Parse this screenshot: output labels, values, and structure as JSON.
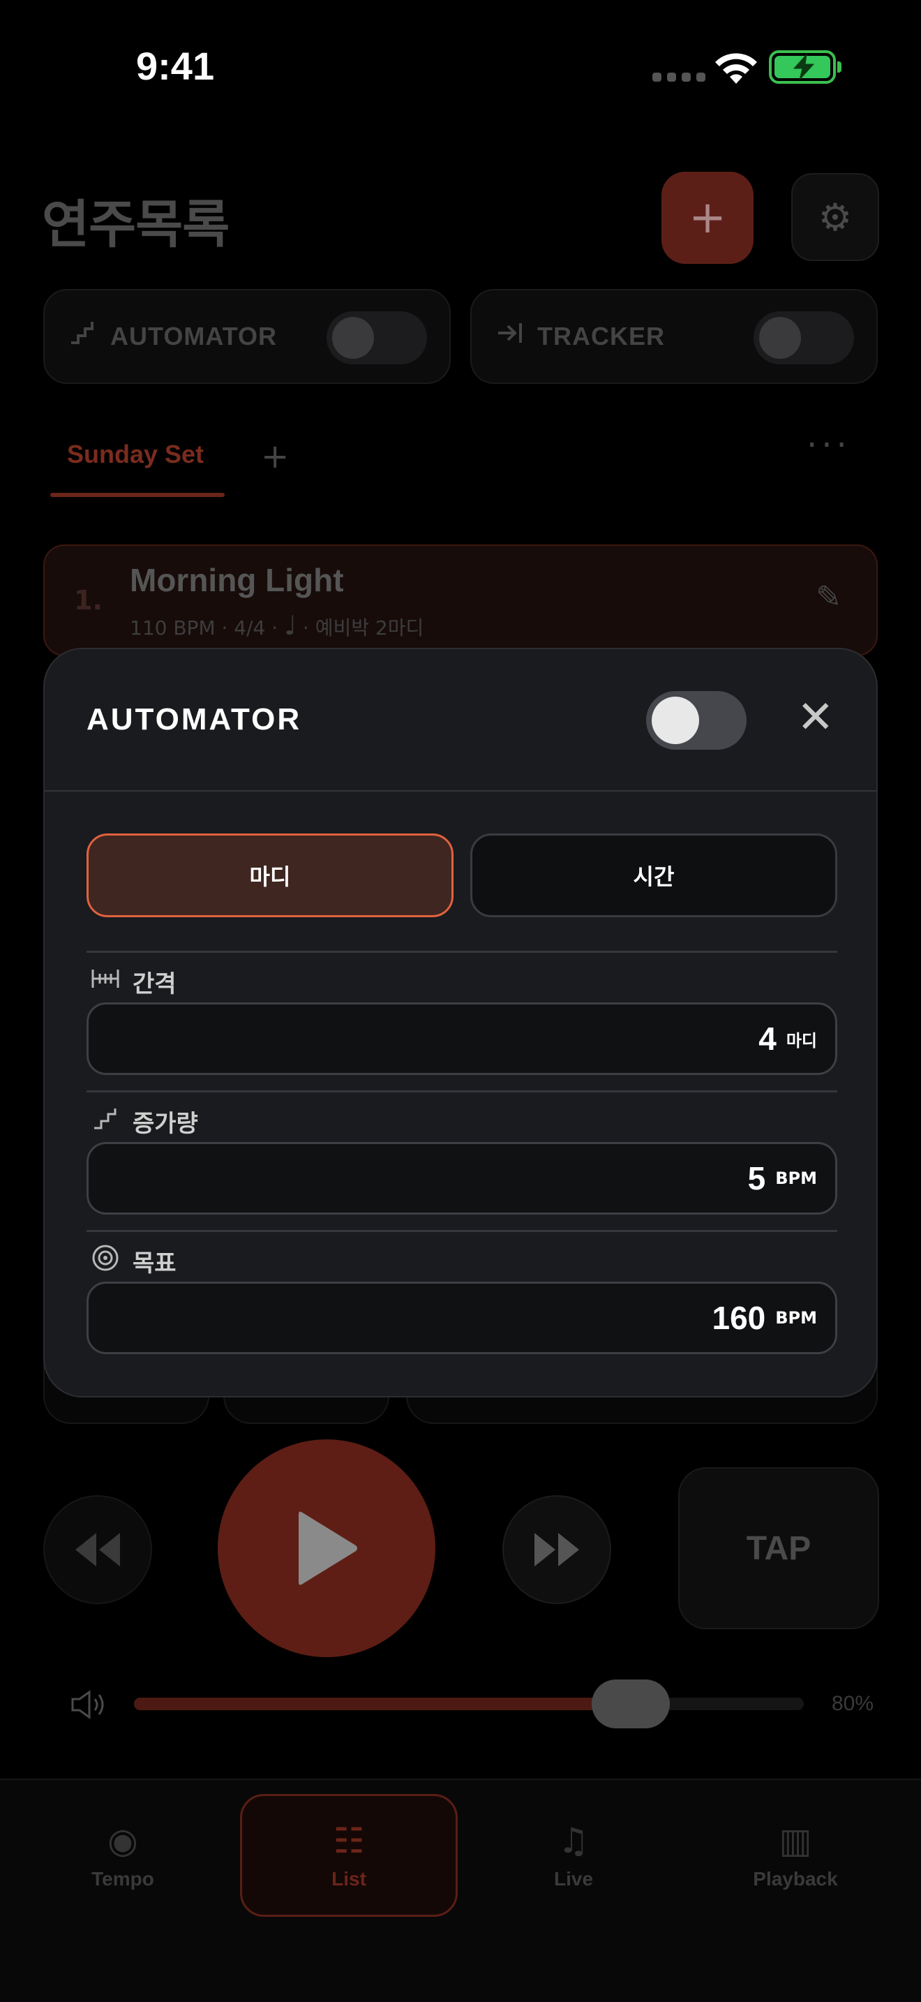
{
  "status_bar": {
    "time": "9:41"
  },
  "header": {
    "title": "연주목록",
    "add_icon": "plus-icon",
    "settings_icon": "gear-icon"
  },
  "toggles": [
    {
      "label": "AUTOMATOR",
      "icon": "stairs-icon",
      "on": false
    },
    {
      "label": "TRACKER",
      "icon": "arrow-to-line-icon",
      "on": false
    }
  ],
  "setlist_tabs": {
    "active": "Sunday Set",
    "more": "···"
  },
  "songs": [
    {
      "number": "1.",
      "title": "Morning Light",
      "meta_prefix": "110 BPM · 4/4 · ",
      "meta_suffix": " · 예비박 2마디"
    }
  ],
  "transport": {
    "tap_label": "TAP"
  },
  "volume": {
    "percent": 80,
    "label": "80%"
  },
  "bottom_nav": [
    {
      "label": "Tempo",
      "icon": "target-icon",
      "active": false
    },
    {
      "label": "List",
      "icon": "list-icon",
      "active": true
    },
    {
      "label": "Live",
      "icon": "music-note-icon",
      "active": false
    },
    {
      "label": "Playback",
      "icon": "playback-icon",
      "active": false
    }
  ],
  "automator_modal": {
    "title": "AUTOMATOR",
    "enabled": false,
    "modes": [
      {
        "label": "마디",
        "selected": true
      },
      {
        "label": "시간",
        "selected": false
      }
    ],
    "fields": {
      "interval": {
        "label": "간격",
        "value": "4",
        "unit": "마디"
      },
      "increment": {
        "label": "증가량",
        "value": "5",
        "unit": "BPM"
      },
      "target": {
        "label": "목표",
        "value": "160",
        "unit": "BPM"
      }
    }
  },
  "colors": {
    "accent": "#e0623f",
    "modal_bg": "#1a1b1e",
    "battery_green": "#34c759"
  }
}
